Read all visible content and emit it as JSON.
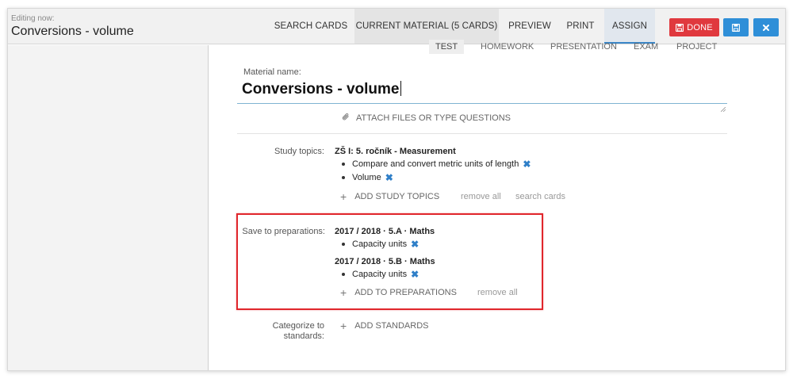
{
  "header": {
    "editing_label": "Editing now:",
    "title": "Conversions - volume",
    "tabs": [
      {
        "label": "SEARCH CARDS"
      },
      {
        "label": "CURRENT MATERIAL (5 CARDS)"
      },
      {
        "label": "PREVIEW"
      },
      {
        "label": "PRINT"
      },
      {
        "label": "ASSIGN"
      }
    ],
    "done_label": "DONE"
  },
  "material_types": [
    "TEST",
    "HOMEWORK",
    "PRESENTATION",
    "EXAM",
    "PROJECT"
  ],
  "material": {
    "name_label": "Material name:",
    "name_value": "Conversions - volume",
    "attach_label": "ATTACH FILES OR TYPE QUESTIONS"
  },
  "study_topics": {
    "label": "Study topics:",
    "group": "ZŠ I: 5. ročník - Measurement",
    "items": [
      "Compare and convert metric units of length",
      "Volume"
    ],
    "add_label": "ADD STUDY TOPICS",
    "remove_all": "remove all",
    "search_cards": "search cards"
  },
  "preparations": {
    "label": "Save to preparations:",
    "groups": [
      {
        "title": "2017 / 2018 · 5.A · Maths",
        "items": [
          "Capacity units"
        ]
      },
      {
        "title": "2017 / 2018 · 5.B · Maths",
        "items": [
          "Capacity units"
        ]
      }
    ],
    "add_label": "ADD TO PREPARATIONS",
    "remove_all": "remove all"
  },
  "standards": {
    "label_line1": "Categorize to",
    "label_line2": "standards:",
    "add_label": "ADD STANDARDS"
  },
  "colors": {
    "done_button": "#e0393e",
    "primary_button": "#2f8fd8",
    "highlight": "#e0262c",
    "remove_icon": "#2f7fc8"
  },
  "icons": {
    "done": "save-icon",
    "save": "save-icon",
    "close": "close-icon",
    "attach": "paperclip-icon",
    "remove": "remove-x-icon",
    "add": "plus-icon"
  }
}
